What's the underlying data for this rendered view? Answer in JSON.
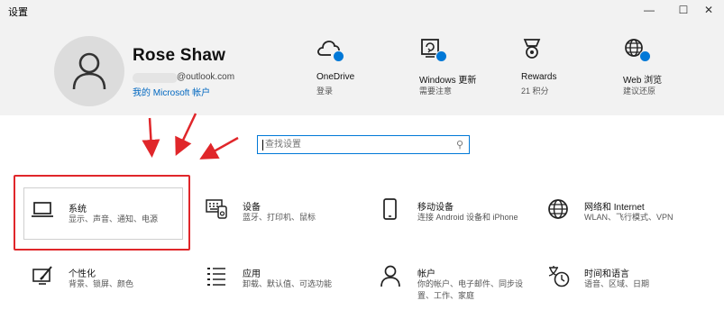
{
  "window": {
    "title": "设置",
    "minimize_icon": "minimize-icon",
    "maximize_icon": "maximize-icon",
    "close_icon": "close-icon"
  },
  "account": {
    "name": "Rose Shaw",
    "email": "@outlook.com",
    "link": "我的 Microsoft 帐户",
    "avatar_icon": "person-icon"
  },
  "header_items": [
    {
      "label": "OneDrive",
      "sub": "登录",
      "icon": "cloud-icon"
    },
    {
      "label": "Windows 更新",
      "sub": "需要注意",
      "icon": "windows-update-icon"
    },
    {
      "label": "Rewards",
      "sub": "21 积分",
      "icon": "medal-icon"
    },
    {
      "label": "Web 浏览",
      "sub": "建议还原",
      "icon": "globe-icon"
    }
  ],
  "search": {
    "placeholder": "查找设置",
    "icon": "search-icon"
  },
  "categories": [
    {
      "title": "系统",
      "sub": "显示、声音、通知、电源",
      "icon": "laptop-icon"
    },
    {
      "title": "设备",
      "sub": "蓝牙、打印机、鼠标",
      "icon": "keyboard-icon"
    },
    {
      "title": "移动设备",
      "sub": "连接 Android 设备和 iPhone",
      "icon": "phone-icon"
    },
    {
      "title": "网络和 Internet",
      "sub": "WLAN、飞行模式、VPN",
      "icon": "globe-icon"
    },
    {
      "title": "个性化",
      "sub": "背景、锁屏、颜色",
      "icon": "paint-icon"
    },
    {
      "title": "应用",
      "sub": "卸载、默认值、可选功能",
      "icon": "apps-list-icon"
    },
    {
      "title": "帐户",
      "sub": "你的帐户、电子邮件、同步设置、工作、家庭",
      "icon": "person-icon"
    },
    {
      "title": "时间和语言",
      "sub": "语音、区域、日期",
      "icon": "time-language-icon"
    }
  ],
  "colors": {
    "accent": "#0078d7",
    "highlight": "#e0262a",
    "header_bg": "#f2f2f2",
    "link": "#0067c0"
  }
}
